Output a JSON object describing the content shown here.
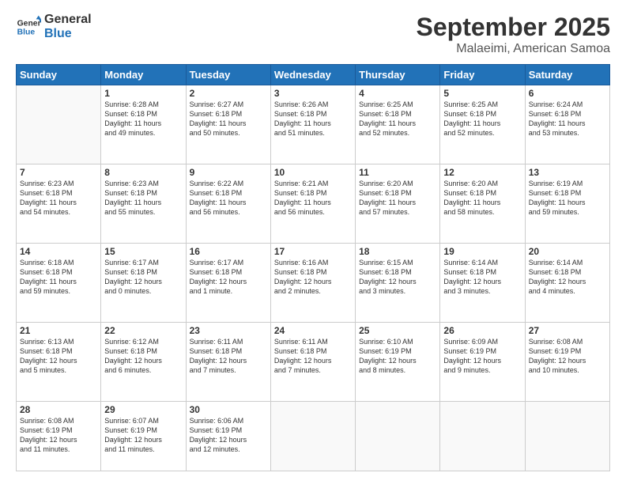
{
  "header": {
    "logo_general": "General",
    "logo_blue": "Blue",
    "month": "September 2025",
    "location": "Malaeimi, American Samoa"
  },
  "weekdays": [
    "Sunday",
    "Monday",
    "Tuesday",
    "Wednesday",
    "Thursday",
    "Friday",
    "Saturday"
  ],
  "weeks": [
    [
      {
        "day": "",
        "content": ""
      },
      {
        "day": "1",
        "content": "Sunrise: 6:28 AM\nSunset: 6:18 PM\nDaylight: 11 hours\nand 49 minutes."
      },
      {
        "day": "2",
        "content": "Sunrise: 6:27 AM\nSunset: 6:18 PM\nDaylight: 11 hours\nand 50 minutes."
      },
      {
        "day": "3",
        "content": "Sunrise: 6:26 AM\nSunset: 6:18 PM\nDaylight: 11 hours\nand 51 minutes."
      },
      {
        "day": "4",
        "content": "Sunrise: 6:25 AM\nSunset: 6:18 PM\nDaylight: 11 hours\nand 52 minutes."
      },
      {
        "day": "5",
        "content": "Sunrise: 6:25 AM\nSunset: 6:18 PM\nDaylight: 11 hours\nand 52 minutes."
      },
      {
        "day": "6",
        "content": "Sunrise: 6:24 AM\nSunset: 6:18 PM\nDaylight: 11 hours\nand 53 minutes."
      }
    ],
    [
      {
        "day": "7",
        "content": "Sunrise: 6:23 AM\nSunset: 6:18 PM\nDaylight: 11 hours\nand 54 minutes."
      },
      {
        "day": "8",
        "content": "Sunrise: 6:23 AM\nSunset: 6:18 PM\nDaylight: 11 hours\nand 55 minutes."
      },
      {
        "day": "9",
        "content": "Sunrise: 6:22 AM\nSunset: 6:18 PM\nDaylight: 11 hours\nand 56 minutes."
      },
      {
        "day": "10",
        "content": "Sunrise: 6:21 AM\nSunset: 6:18 PM\nDaylight: 11 hours\nand 56 minutes."
      },
      {
        "day": "11",
        "content": "Sunrise: 6:20 AM\nSunset: 6:18 PM\nDaylight: 11 hours\nand 57 minutes."
      },
      {
        "day": "12",
        "content": "Sunrise: 6:20 AM\nSunset: 6:18 PM\nDaylight: 11 hours\nand 58 minutes."
      },
      {
        "day": "13",
        "content": "Sunrise: 6:19 AM\nSunset: 6:18 PM\nDaylight: 11 hours\nand 59 minutes."
      }
    ],
    [
      {
        "day": "14",
        "content": "Sunrise: 6:18 AM\nSunset: 6:18 PM\nDaylight: 11 hours\nand 59 minutes."
      },
      {
        "day": "15",
        "content": "Sunrise: 6:17 AM\nSunset: 6:18 PM\nDaylight: 12 hours\nand 0 minutes."
      },
      {
        "day": "16",
        "content": "Sunrise: 6:17 AM\nSunset: 6:18 PM\nDaylight: 12 hours\nand 1 minute."
      },
      {
        "day": "17",
        "content": "Sunrise: 6:16 AM\nSunset: 6:18 PM\nDaylight: 12 hours\nand 2 minutes."
      },
      {
        "day": "18",
        "content": "Sunrise: 6:15 AM\nSunset: 6:18 PM\nDaylight: 12 hours\nand 3 minutes."
      },
      {
        "day": "19",
        "content": "Sunrise: 6:14 AM\nSunset: 6:18 PM\nDaylight: 12 hours\nand 3 minutes."
      },
      {
        "day": "20",
        "content": "Sunrise: 6:14 AM\nSunset: 6:18 PM\nDaylight: 12 hours\nand 4 minutes."
      }
    ],
    [
      {
        "day": "21",
        "content": "Sunrise: 6:13 AM\nSunset: 6:18 PM\nDaylight: 12 hours\nand 5 minutes."
      },
      {
        "day": "22",
        "content": "Sunrise: 6:12 AM\nSunset: 6:18 PM\nDaylight: 12 hours\nand 6 minutes."
      },
      {
        "day": "23",
        "content": "Sunrise: 6:11 AM\nSunset: 6:18 PM\nDaylight: 12 hours\nand 7 minutes."
      },
      {
        "day": "24",
        "content": "Sunrise: 6:11 AM\nSunset: 6:18 PM\nDaylight: 12 hours\nand 7 minutes."
      },
      {
        "day": "25",
        "content": "Sunrise: 6:10 AM\nSunset: 6:19 PM\nDaylight: 12 hours\nand 8 minutes."
      },
      {
        "day": "26",
        "content": "Sunrise: 6:09 AM\nSunset: 6:19 PM\nDaylight: 12 hours\nand 9 minutes."
      },
      {
        "day": "27",
        "content": "Sunrise: 6:08 AM\nSunset: 6:19 PM\nDaylight: 12 hours\nand 10 minutes."
      }
    ],
    [
      {
        "day": "28",
        "content": "Sunrise: 6:08 AM\nSunset: 6:19 PM\nDaylight: 12 hours\nand 11 minutes."
      },
      {
        "day": "29",
        "content": "Sunrise: 6:07 AM\nSunset: 6:19 PM\nDaylight: 12 hours\nand 11 minutes."
      },
      {
        "day": "30",
        "content": "Sunrise: 6:06 AM\nSunset: 6:19 PM\nDaylight: 12 hours\nand 12 minutes."
      },
      {
        "day": "",
        "content": ""
      },
      {
        "day": "",
        "content": ""
      },
      {
        "day": "",
        "content": ""
      },
      {
        "day": "",
        "content": ""
      }
    ]
  ]
}
